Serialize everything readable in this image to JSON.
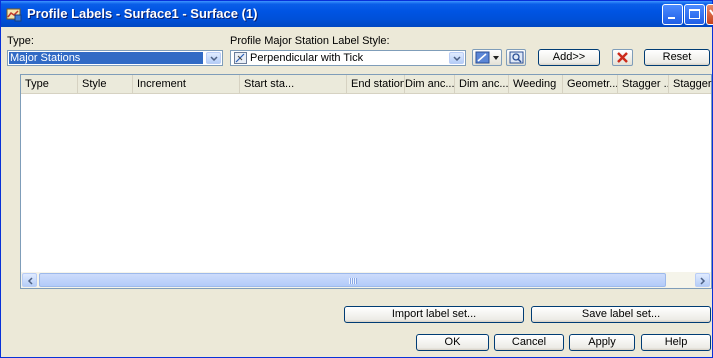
{
  "window": {
    "title": "Profile Labels - Surface1 - Surface (1)"
  },
  "type_field": {
    "label": "Type:",
    "value": "Major Stations"
  },
  "style_field": {
    "label": "Profile Major Station Label Style:",
    "value": "Perpendicular with Tick"
  },
  "toolbar": {
    "add_label": "Add>>",
    "reset_label": "Reset"
  },
  "table": {
    "columns": [
      "Type",
      "Style",
      "Increment",
      "Start sta...",
      "End station",
      "Dim anc...",
      "Dim anc...",
      "Weeding",
      "Geometr...",
      "Stagger ...",
      "Stagger ..."
    ],
    "rows": []
  },
  "footer": {
    "import_label": "Import label set...",
    "save_label": "Save label set...",
    "ok_label": "OK",
    "cancel_label": "Cancel",
    "apply_label": "Apply",
    "help_label": "Help"
  },
  "icons": {
    "title": "profile-labels-icon",
    "style_edit": "edit-style-icon",
    "style_preview": "preview-style-icon",
    "delete": "delete-x-icon",
    "type_dropdown": "chevron-down-icon"
  },
  "colors": {
    "titlebar": "#0054e3",
    "selection": "#316ac5",
    "dialog_bg": "#ece9d8",
    "delete_icon": "#cc2a1a"
  }
}
